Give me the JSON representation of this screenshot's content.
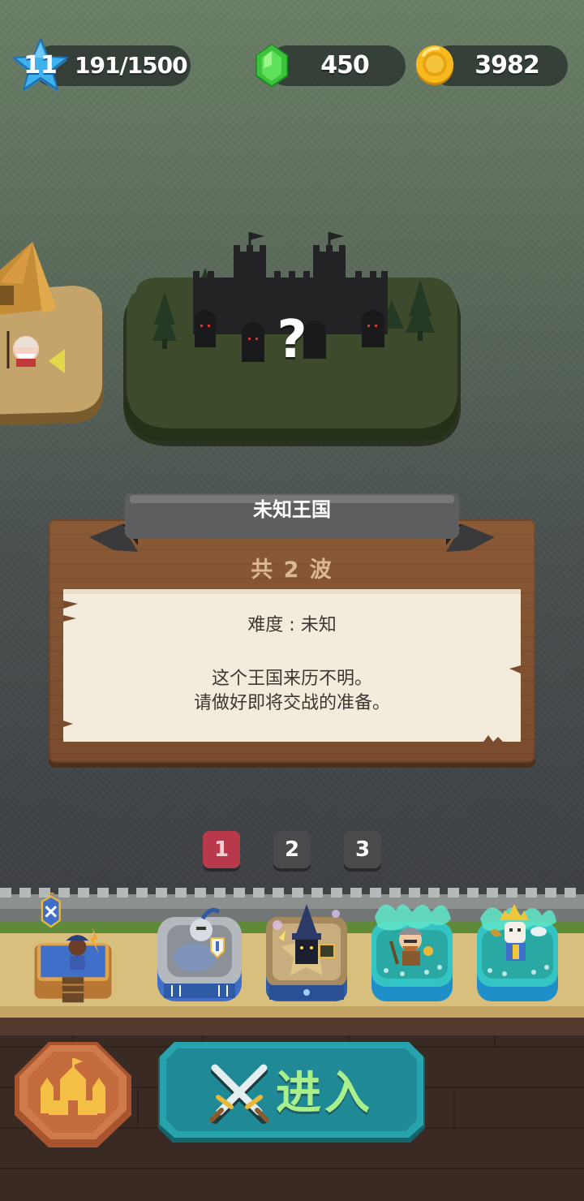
{
  "hud": {
    "level": "11",
    "xp": "191/1500",
    "gems": "450",
    "coins": "3982"
  },
  "map": {
    "mystery_mark": "?"
  },
  "panel": {
    "title": "未知王国",
    "waves": "共 2 波",
    "difficulty": "难度 : 未知",
    "description_line1": "这个王国来历不明。",
    "description_line2": "请做好即将交战的准备。"
  },
  "pages": [
    {
      "label": "1",
      "active": true
    },
    {
      "label": "2",
      "active": false
    },
    {
      "label": "3",
      "active": false
    }
  ],
  "towers": [
    "castle-tower",
    "knight-tower",
    "wizard-tower",
    "barbarian-tower",
    "paladin-tower"
  ],
  "buttons": {
    "enter": "进入"
  },
  "colors": {
    "gem": "#3bc43b",
    "coin": "#f2b51c",
    "level_star": "#37a7e8",
    "active_tab": "#b8394a",
    "enter_button": "#1f8a95",
    "enter_text": "#a9ef8c",
    "castle_button": "#c2693e",
    "panel_wood": "#8a5a37",
    "parchment": "#f3ecdc"
  }
}
